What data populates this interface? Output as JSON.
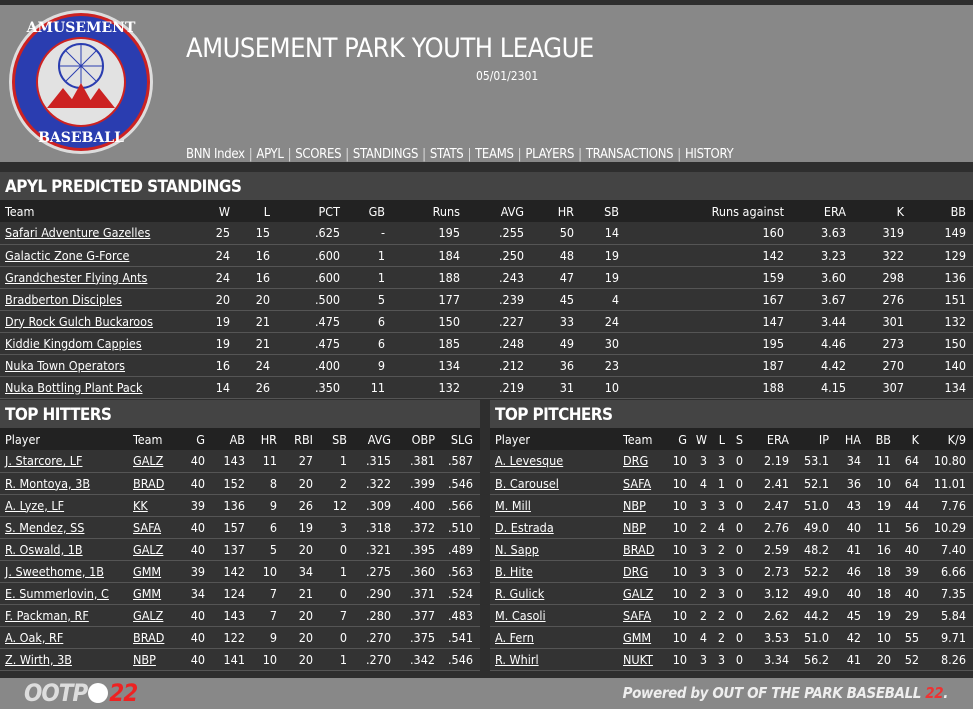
{
  "header": {
    "title": "AMUSEMENT PARK YOUTH LEAGUE",
    "date": "05/01/2301",
    "logo_text_top": "AMUSEMENT",
    "logo_text_bottom": "BASEBALL",
    "nav": [
      "BNN Index",
      "APYL",
      "SCORES",
      "STANDINGS",
      "STATS",
      "TEAMS",
      "PLAYERS",
      "TRANSACTIONS",
      "HISTORY"
    ]
  },
  "standings": {
    "title": "APYL PREDICTED STANDINGS",
    "columns": [
      "Team",
      "W",
      "L",
      "PCT",
      "GB",
      "Runs",
      "AVG",
      "HR",
      "SB",
      "Runs against",
      "ERA",
      "K",
      "BB"
    ],
    "rows": [
      [
        "Safari Adventure Gazelles",
        "25",
        "15",
        ".625",
        "-",
        "195",
        ".255",
        "50",
        "14",
        "160",
        "3.63",
        "319",
        "149"
      ],
      [
        "Galactic Zone G-Force",
        "24",
        "16",
        ".600",
        "1",
        "184",
        ".250",
        "48",
        "19",
        "142",
        "3.23",
        "322",
        "129"
      ],
      [
        "Grandchester Flying Ants",
        "24",
        "16",
        ".600",
        "1",
        "188",
        ".243",
        "47",
        "19",
        "159",
        "3.60",
        "298",
        "136"
      ],
      [
        "Bradberton Disciples",
        "20",
        "20",
        ".500",
        "5",
        "177",
        ".239",
        "45",
        "4",
        "167",
        "3.67",
        "276",
        "151"
      ],
      [
        "Dry Rock Gulch Buckaroos",
        "19",
        "21",
        ".475",
        "6",
        "150",
        ".227",
        "33",
        "24",
        "147",
        "3.44",
        "301",
        "132"
      ],
      [
        "Kiddie Kingdom Cappies",
        "19",
        "21",
        ".475",
        "6",
        "185",
        ".248",
        "49",
        "30",
        "195",
        "4.46",
        "273",
        "150"
      ],
      [
        "Nuka Town Operators",
        "16",
        "24",
        ".400",
        "9",
        "134",
        ".212",
        "36",
        "23",
        "187",
        "4.42",
        "270",
        "140"
      ],
      [
        "Nuka Bottling Plant Pack",
        "14",
        "26",
        ".350",
        "11",
        "132",
        ".219",
        "31",
        "10",
        "188",
        "4.15",
        "307",
        "134"
      ]
    ]
  },
  "hitters": {
    "title": "TOP HITTERS",
    "columns": [
      "Player",
      "Team",
      "G",
      "AB",
      "HR",
      "RBI",
      "SB",
      "AVG",
      "OBP",
      "SLG"
    ],
    "rows": [
      [
        "J. Starcore, LF",
        "GALZ",
        "40",
        "143",
        "11",
        "27",
        "1",
        ".315",
        ".381",
        ".587"
      ],
      [
        "R. Montoya, 3B",
        "BRAD",
        "40",
        "152",
        "8",
        "20",
        "2",
        ".322",
        ".399",
        ".546"
      ],
      [
        "A. Lyze, LF",
        "KK",
        "39",
        "136",
        "9",
        "26",
        "12",
        ".309",
        ".400",
        ".566"
      ],
      [
        "S. Mendez, SS",
        "SAFA",
        "40",
        "157",
        "6",
        "19",
        "3",
        ".318",
        ".372",
        ".510"
      ],
      [
        "R. Oswald, 1B",
        "GALZ",
        "40",
        "137",
        "5",
        "20",
        "0",
        ".321",
        ".395",
        ".489"
      ],
      [
        "J. Sweethome, 1B",
        "GMM",
        "39",
        "142",
        "10",
        "34",
        "1",
        ".275",
        ".360",
        ".563"
      ],
      [
        "E. Summerlovin, C",
        "GMM",
        "34",
        "124",
        "7",
        "21",
        "0",
        ".290",
        ".371",
        ".524"
      ],
      [
        "F. Packman, RF",
        "GALZ",
        "40",
        "143",
        "7",
        "20",
        "7",
        ".280",
        ".377",
        ".483"
      ],
      [
        "A. Oak, RF",
        "BRAD",
        "40",
        "122",
        "9",
        "20",
        "0",
        ".270",
        ".375",
        ".541"
      ],
      [
        "Z. Wirth, 3B",
        "NBP",
        "40",
        "141",
        "10",
        "20",
        "1",
        ".270",
        ".342",
        ".546"
      ]
    ]
  },
  "pitchers": {
    "title": "TOP PITCHERS",
    "columns": [
      "Player",
      "Team",
      "G",
      "W",
      "L",
      "S",
      "ERA",
      "IP",
      "HA",
      "BB",
      "K",
      "K/9"
    ],
    "rows": [
      [
        "A. Levesque",
        "DRG",
        "10",
        "3",
        "3",
        "0",
        "2.19",
        "53.1",
        "34",
        "11",
        "64",
        "10.80"
      ],
      [
        "B. Carousel",
        "SAFA",
        "10",
        "4",
        "1",
        "0",
        "2.41",
        "52.1",
        "36",
        "10",
        "64",
        "11.01"
      ],
      [
        "M. Mill",
        "NBP",
        "10",
        "3",
        "3",
        "0",
        "2.47",
        "51.0",
        "43",
        "19",
        "44",
        "7.76"
      ],
      [
        "D. Estrada",
        "NBP",
        "10",
        "2",
        "4",
        "0",
        "2.76",
        "49.0",
        "40",
        "11",
        "56",
        "10.29"
      ],
      [
        "N. Sapp",
        "BRAD",
        "10",
        "3",
        "2",
        "0",
        "2.59",
        "48.2",
        "41",
        "16",
        "40",
        "7.40"
      ],
      [
        "B. Hite",
        "DRG",
        "10",
        "3",
        "3",
        "0",
        "2.73",
        "52.2",
        "46",
        "18",
        "39",
        "6.66"
      ],
      [
        "R. Gulick",
        "GALZ",
        "10",
        "2",
        "3",
        "0",
        "3.12",
        "49.0",
        "40",
        "18",
        "40",
        "7.35"
      ],
      [
        "M. Casoli",
        "SAFA",
        "10",
        "2",
        "2",
        "0",
        "2.62",
        "44.2",
        "45",
        "19",
        "29",
        "5.84"
      ],
      [
        "A. Fern",
        "GMM",
        "10",
        "4",
        "2",
        "0",
        "3.53",
        "51.0",
        "42",
        "10",
        "55",
        "9.71"
      ],
      [
        "R. Whirl",
        "NUKT",
        "10",
        "3",
        "3",
        "0",
        "3.34",
        "56.2",
        "41",
        "20",
        "52",
        "8.26"
      ]
    ]
  },
  "footer": {
    "ootp_text": "OOTP",
    "ootp_num": "22",
    "powered": "Powered by ",
    "powered_brand": "OUT OF THE PARK BASEBALL ",
    "powered_num": "22",
    "powered_dot": "."
  }
}
